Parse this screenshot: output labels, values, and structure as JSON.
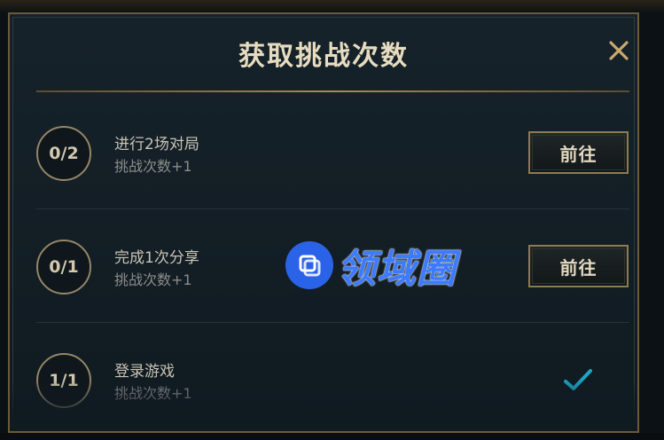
{
  "dialog": {
    "title": "获取挑战次数",
    "close_icon": "close-icon"
  },
  "tasks": [
    {
      "progress": "0/2",
      "title": "进行2场对局",
      "reward": "挑战次数+1",
      "action_label": "前往",
      "completed": false
    },
    {
      "progress": "0/1",
      "title": "完成1次分享",
      "reward": "挑战次数+1",
      "action_label": "前往",
      "completed": false
    },
    {
      "progress": "1/1",
      "title": "登录游戏",
      "reward": "挑战次数+1",
      "action_label": "",
      "completed": true,
      "status_icon": "checkmark-icon"
    }
  ],
  "watermark": {
    "text": "领域圈",
    "logo_color": "#2b63e8"
  },
  "colors": {
    "accent_gold": "#c8aa6e",
    "check_teal": "#1aa6c4",
    "dialog_bg": "#16222a"
  }
}
